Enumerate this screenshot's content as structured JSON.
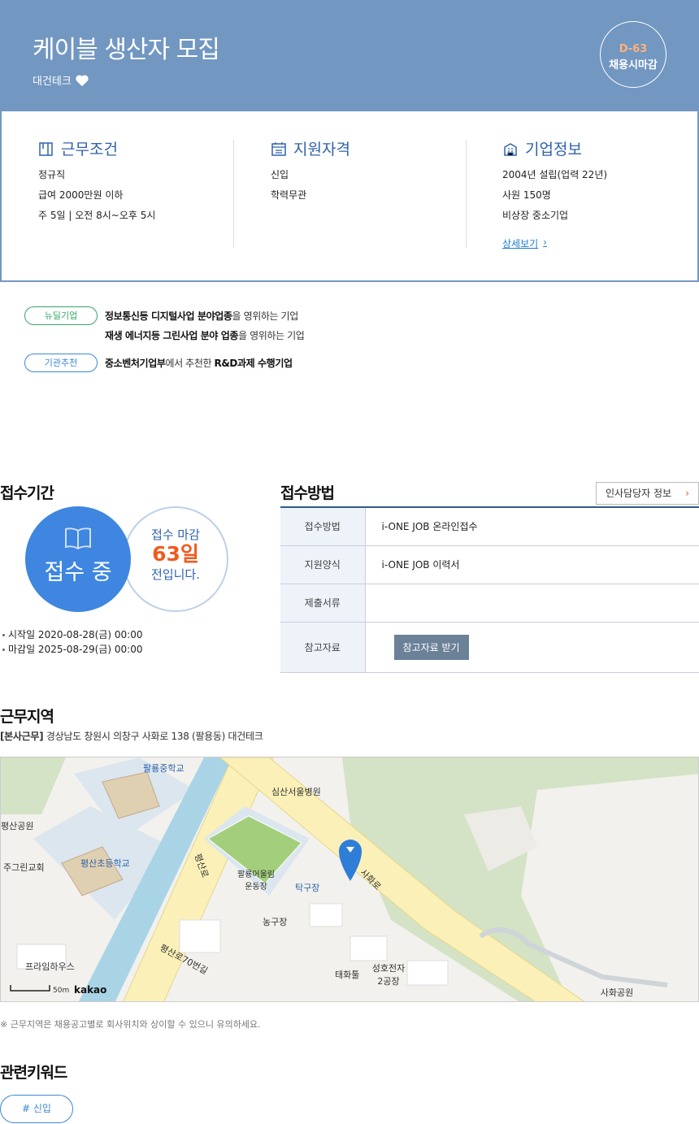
{
  "header": {
    "title": "케이블 생산자 모집",
    "company": "대건테크",
    "dday": "D-63",
    "deadline_label": "채용시마감"
  },
  "info": {
    "work": {
      "title": "근무조건",
      "items": [
        "정규직",
        "급여 2000만원 이하",
        "주 5일 | 오전 8시~오후 5시"
      ]
    },
    "qual": {
      "title": "지원자격",
      "items": [
        "신입",
        "학력무관"
      ]
    },
    "corp": {
      "title": "기업정보",
      "items": [
        "2004년 설립(업력 22년)",
        "사원 150명",
        "비상장 중소기업"
      ],
      "detail_link": "상세보기"
    }
  },
  "badges": [
    {
      "label": "뉴딜기업",
      "lines": [
        {
          "bold": "정보통신등 디지털사업 분야업종",
          "rest": "을 영위하는 기업"
        },
        {
          "bold": "재생 에너지등 그린사업 분야 업종",
          "rest": "을 영위하는 기업"
        }
      ]
    },
    {
      "label": "기관추천",
      "lines": [
        {
          "bold": "중소벤처기업부",
          "rest": "에서 추천한 ",
          "bold2": "R&D과제 수행기업"
        }
      ]
    }
  ],
  "reception": {
    "title": "접수기간",
    "status": "접수 중",
    "remain_top": "접수 마감",
    "remain_days": "63일",
    "remain_bottom": "전입니다.",
    "start": "시작일 2020-08-28(금) 00:00",
    "end": "마감일 2025-08-29(금) 00:00"
  },
  "method": {
    "title": "접수방법",
    "hr_button": "인사담당자 정보",
    "rows": [
      {
        "key": "접수방법",
        "value": "i-ONE JOB 온라인접수"
      },
      {
        "key": "지원양식",
        "value": "i-ONE JOB 이력서"
      },
      {
        "key": "제출서류",
        "value": ""
      },
      {
        "key": "참고자료",
        "button": "참고자료 받기"
      }
    ]
  },
  "location": {
    "title": "근무지역",
    "addr_label": "[본사근무]",
    "address": "경상남도 창원시 의창구 사화로 138 (팔용동) 대건테크",
    "note": "※ 근무지역은 채용공고별로 회사위치와 상이할 수 있으니 유의하세요.",
    "map_labels": {
      "school1": "팔룡중학교",
      "hospital": "심산서울병원",
      "park1": "평산공원",
      "church": "주그린교회",
      "school2": "평산초등학교",
      "road1": "평산로",
      "field": "팔룡어울림 운동장",
      "tabletennis": "탁구장",
      "road2": "사화로",
      "basketball": "농구장",
      "road3": "평산로70번길",
      "house": "프라임하우스",
      "tool": "태화툴",
      "factory": "성호전자 2공장",
      "park2": "사화공원 풋살장",
      "scale": "50m",
      "brand": "kakao"
    }
  },
  "keywords": {
    "title": "관련키워드",
    "items": [
      "# 신입"
    ]
  }
}
